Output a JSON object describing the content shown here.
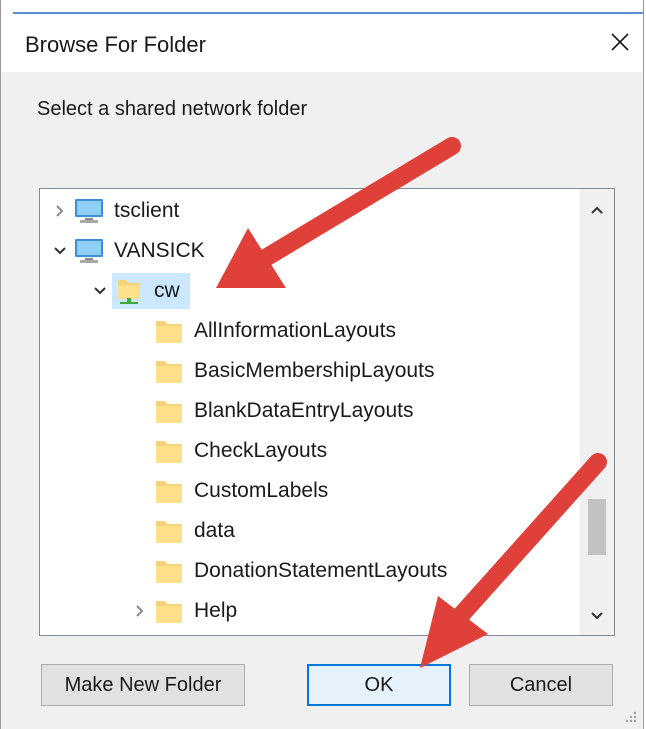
{
  "window": {
    "title": "Browse For Folder"
  },
  "prompt": "Select a shared network folder",
  "tree": {
    "items": [
      {
        "label": "tsclient",
        "level": 0,
        "expanded": false,
        "has_children": true,
        "type": "computer"
      },
      {
        "label": "VANSICK",
        "level": 0,
        "expanded": true,
        "has_children": true,
        "type": "computer"
      },
      {
        "label": "cw",
        "level": 1,
        "expanded": true,
        "has_children": true,
        "type": "shared-folder",
        "selected": true
      },
      {
        "label": "AllInformationLayouts",
        "level": 2,
        "has_children": false,
        "type": "folder"
      },
      {
        "label": "BasicMembershipLayouts",
        "level": 2,
        "has_children": false,
        "type": "folder"
      },
      {
        "label": "BlankDataEntryLayouts",
        "level": 2,
        "has_children": false,
        "type": "folder"
      },
      {
        "label": "CheckLayouts",
        "level": 2,
        "has_children": false,
        "type": "folder"
      },
      {
        "label": "CustomLabels",
        "level": 2,
        "has_children": false,
        "type": "folder"
      },
      {
        "label": "data",
        "level": 2,
        "has_children": false,
        "type": "folder"
      },
      {
        "label": "DonationStatementLayouts",
        "level": 2,
        "has_children": false,
        "type": "folder"
      },
      {
        "label": "Help",
        "level": 2,
        "expanded": false,
        "has_children": true,
        "type": "folder"
      }
    ]
  },
  "buttons": {
    "make_new_folder": "Make New Folder",
    "ok": "OK",
    "cancel": "Cancel"
  },
  "colors": {
    "accent": "#0078d7",
    "selection": "#cce8ff",
    "annotation_arrow": "#e0403a"
  },
  "icons": {
    "close": "close-icon",
    "computer": "monitor-icon",
    "folder": "folder-icon",
    "shared_folder": "shared-folder-icon"
  }
}
